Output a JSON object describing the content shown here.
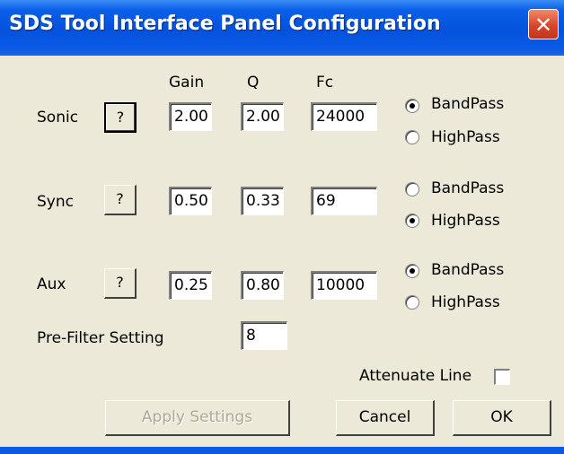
{
  "window": {
    "title": "SDS Tool Interface Panel  Configuration",
    "close_symbol": "✕"
  },
  "columns": {
    "gain": "Gain",
    "q": "Q",
    "fc": "Fc"
  },
  "rows": [
    {
      "name": "Sonic",
      "help": "?",
      "gain": "2.00",
      "q": "2.00",
      "fc": "24000",
      "mode": "BandPass"
    },
    {
      "name": "Sync",
      "help": "?",
      "gain": "0.50",
      "q": "0.33",
      "fc": "69",
      "mode": "HighPass"
    },
    {
      "name": "Aux",
      "help": "?",
      "gain": "0.25",
      "q": "0.80",
      "fc": "10000",
      "mode": "BandPass"
    }
  ],
  "options": {
    "bandpass": "BandPass",
    "highpass": "HighPass"
  },
  "prefilter": {
    "label": "Pre-Filter Setting",
    "value": "8"
  },
  "attenuate": {
    "label": "Attenuate Line",
    "checked": false
  },
  "buttons": {
    "apply": "Apply Settings",
    "cancel": "Cancel",
    "ok": "OK"
  }
}
